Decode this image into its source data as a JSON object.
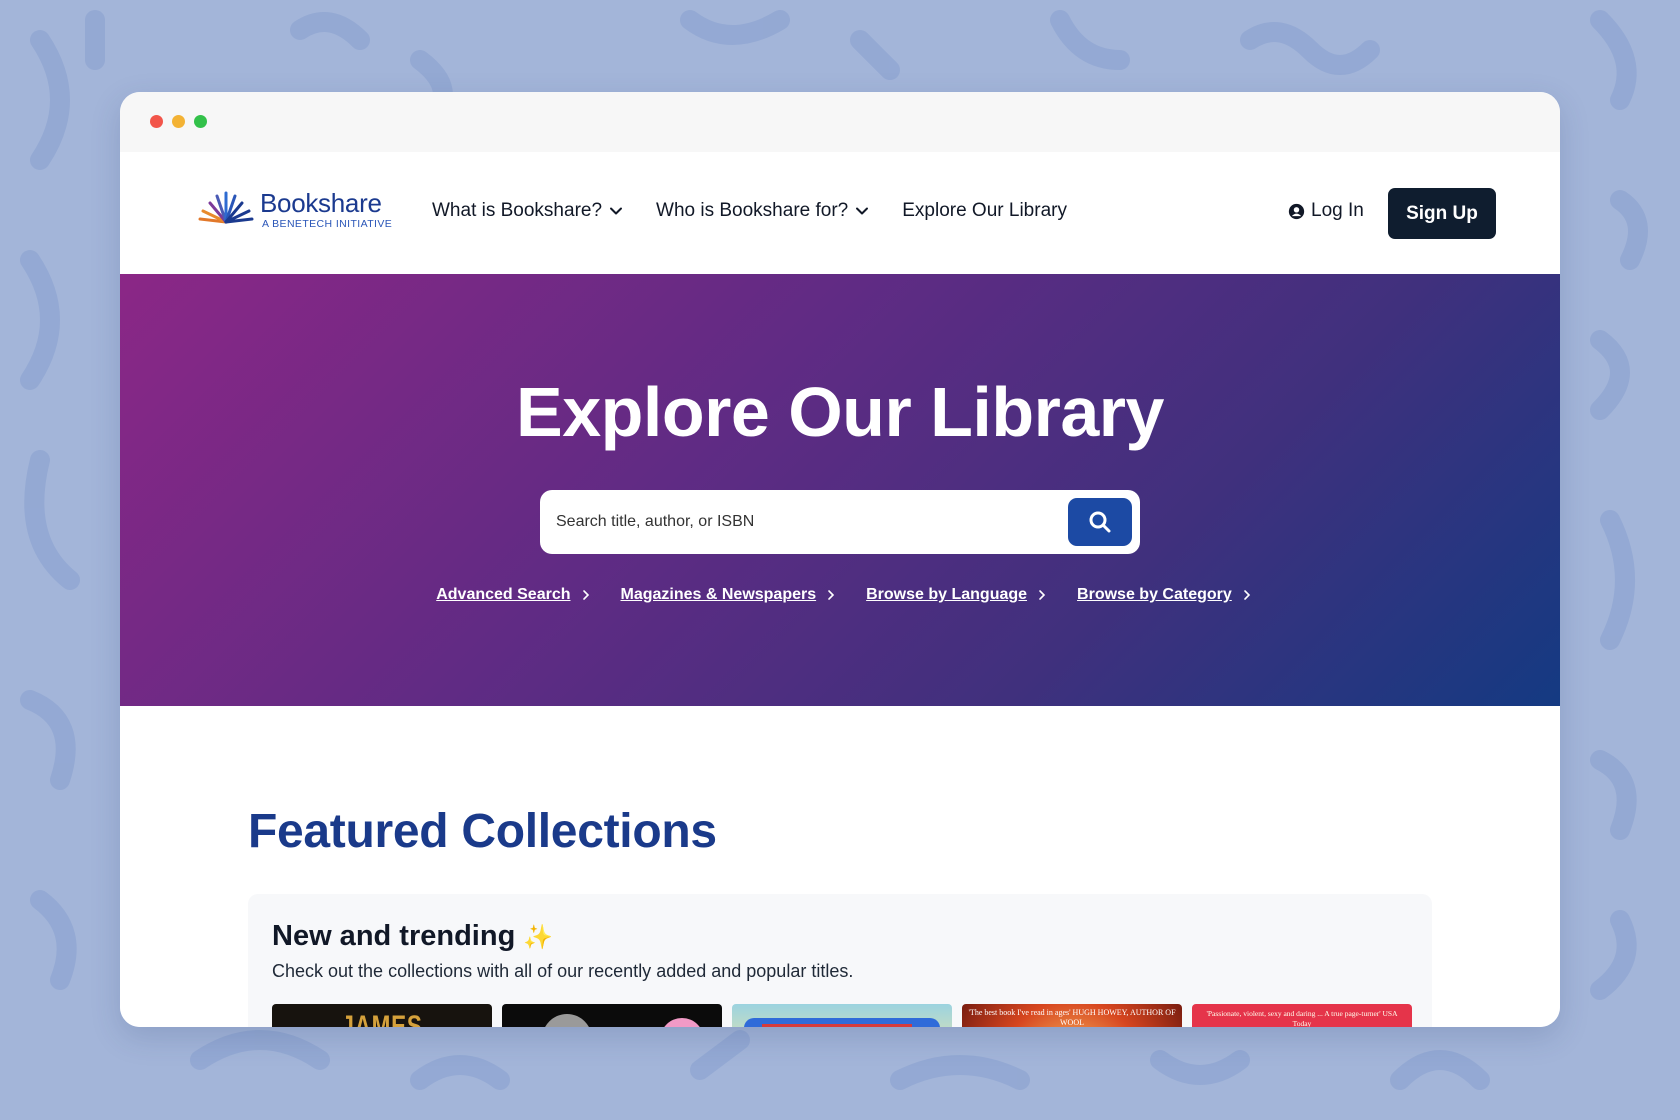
{
  "brand": {
    "name": "Bookshare",
    "tagline": "A BENETECH INITIATIVE"
  },
  "nav": {
    "items": [
      {
        "label": "What is Bookshare?",
        "icon": "chevron-down-icon"
      },
      {
        "label": "Who is Bookshare for?",
        "icon": "chevron-down-icon"
      },
      {
        "label": "Explore Our Library"
      }
    ],
    "login_label": "Log In",
    "signup_label": "Sign Up"
  },
  "hero": {
    "title": "Explore Our Library",
    "search_placeholder": "Search title, author, or ISBN",
    "links": [
      "Advanced Search",
      "Magazines & Newspapers",
      "Browse by Language",
      "Browse by Category"
    ]
  },
  "featured": {
    "title": "Featured Collections",
    "collection": {
      "title": "New and trending",
      "emoji": "✨",
      "description": "Check out the collections with all of our recently added and popular titles.",
      "covers": [
        {
          "text": "JAMES PATTERSON"
        },
        {
          "text": ""
        },
        {
          "text": ""
        },
        {
          "text": "'The best book I've read in ages' HUGH HOWEY, AUTHOR OF WOOL"
        },
        {
          "text": "'Passionate, violent, sexy and daring ... A true page-turner' USA Today"
        }
      ]
    }
  },
  "colors": {
    "background": "#a3b5d9",
    "brand_blue": "#1a3a8a",
    "signup_bg": "#0f1d2f",
    "search_button": "#1c4aa4",
    "hero_gradient_start": "#8b2786",
    "hero_gradient_end": "#143a82"
  }
}
